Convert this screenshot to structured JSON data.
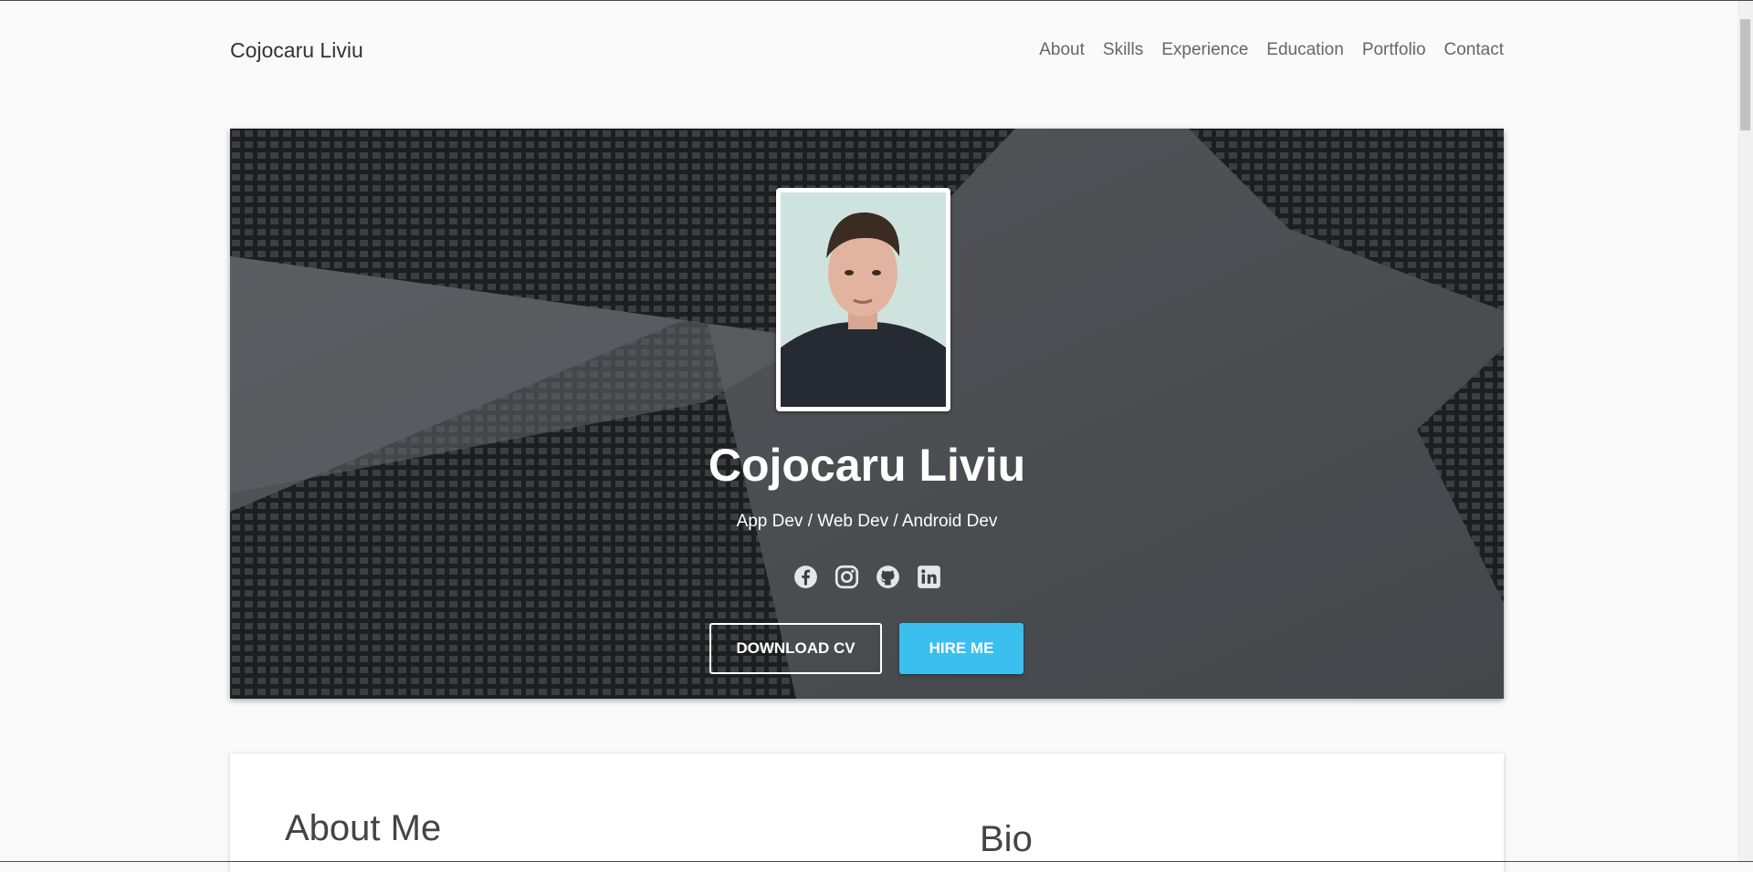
{
  "navbar": {
    "brand": "Cojocaru Liviu",
    "links": [
      "About",
      "Skills",
      "Experience",
      "Education",
      "Portfolio",
      "Contact"
    ]
  },
  "hero": {
    "name": "Cojocaru Liviu",
    "subtitle": "App Dev / Web Dev / Android Dev",
    "social_icons": [
      "facebook-icon",
      "instagram-icon",
      "github-icon",
      "linkedin-icon"
    ],
    "download_label": "DOWNLOAD CV",
    "hire_label": "HIRE ME"
  },
  "about": {
    "title": "About Me",
    "bio_title": "Bio"
  },
  "colors": {
    "accent": "#3bbfee",
    "background": "#fafafa",
    "hero_dark": "#2b2c2e"
  }
}
